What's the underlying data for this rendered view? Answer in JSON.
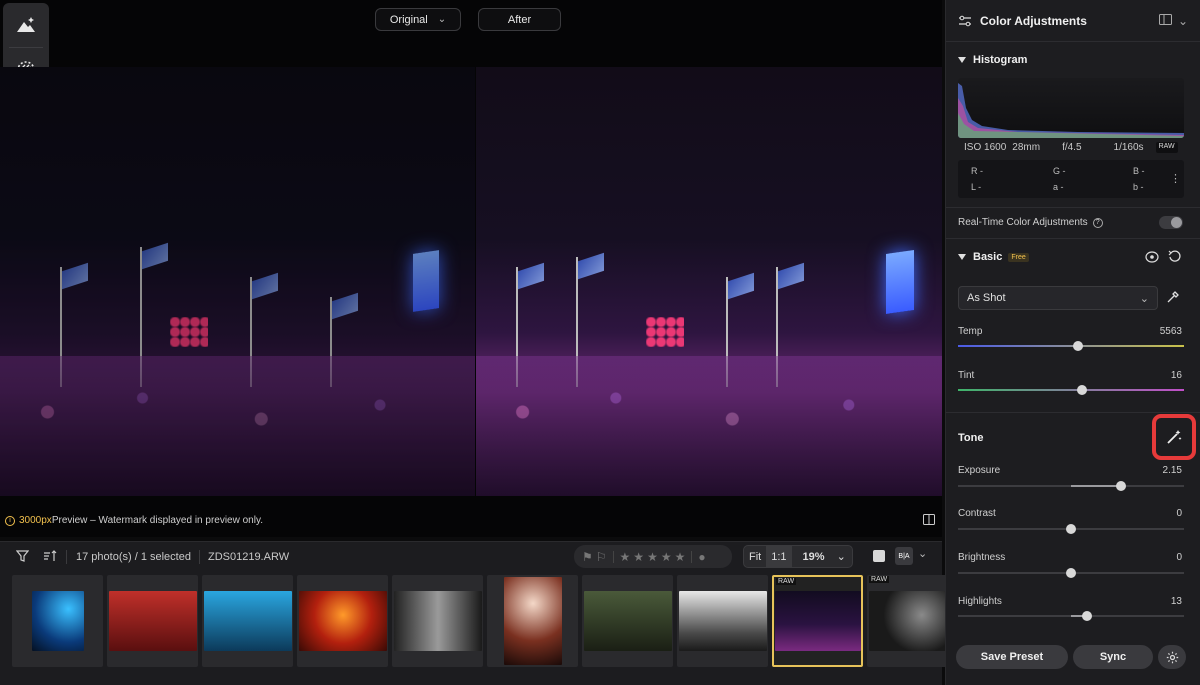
{
  "viewer": {
    "compare_left": "Original",
    "compare_right": "After",
    "preview_size": "3000px",
    "preview_rest": " Preview – Watermark displayed in preview only."
  },
  "filmstrip": {
    "count_text": "17 photo(s) / 1 selected",
    "filename": "ZDS01219.ARW",
    "zoom_fit": "Fit",
    "zoom_1to1": "1:1",
    "zoom_value": "19%",
    "raw_tag": "RAW",
    "ba_label": "B|A",
    "selected_index": 8
  },
  "panel": {
    "title": "Color Adjustments",
    "histogram_title": "Histogram",
    "exif": {
      "iso": "ISO 1600",
      "focal": "28mm",
      "aperture": "f/4.5",
      "shutter": "1/160s",
      "raw": "RAW"
    },
    "rgb": {
      "r": "R -",
      "g": "G -",
      "b": "B -",
      "l": "L -",
      "a": "a -",
      "b2": "b -"
    },
    "realtime_label": "Real-Time Color Adjustments",
    "basic_title": "Basic",
    "free_badge": "Free",
    "profile": "As Shot",
    "temp_label": "Temp",
    "temp_value": "5563",
    "tint_label": "Tint",
    "tint_value": "16",
    "tone_title": "Tone",
    "exposure_label": "Exposure",
    "exposure_value": "2.15",
    "contrast_label": "Contrast",
    "contrast_value": "0",
    "brightness_label": "Brightness",
    "brightness_value": "0",
    "highlights_label": "Highlights",
    "highlights_value": "13",
    "save_preset": "Save Preset",
    "sync": "Sync"
  }
}
